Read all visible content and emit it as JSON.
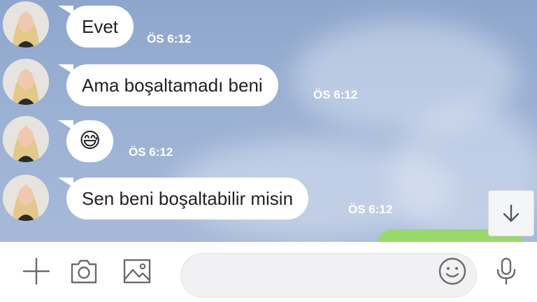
{
  "messages": [
    {
      "text": "Evet",
      "time": "ÖS 6:12"
    },
    {
      "text": "Ama boşaltamadı beni",
      "time": "ÖS 6:12"
    },
    {
      "text": "😅",
      "time": "ÖS 6:12"
    },
    {
      "text": "Sen beni boşaltabilir misin",
      "time": "ÖS 6:12"
    }
  ],
  "toolbar": {
    "icons": [
      "plus-icon",
      "camera-icon",
      "image-icon",
      "emoji-icon",
      "microphone-icon"
    ],
    "input_placeholder": ""
  },
  "colors": {
    "chat_background": "#9bb1d3",
    "bubble": "#ffffff",
    "own_bubble": "#9ad86c",
    "timestamp": "#ffffff"
  }
}
